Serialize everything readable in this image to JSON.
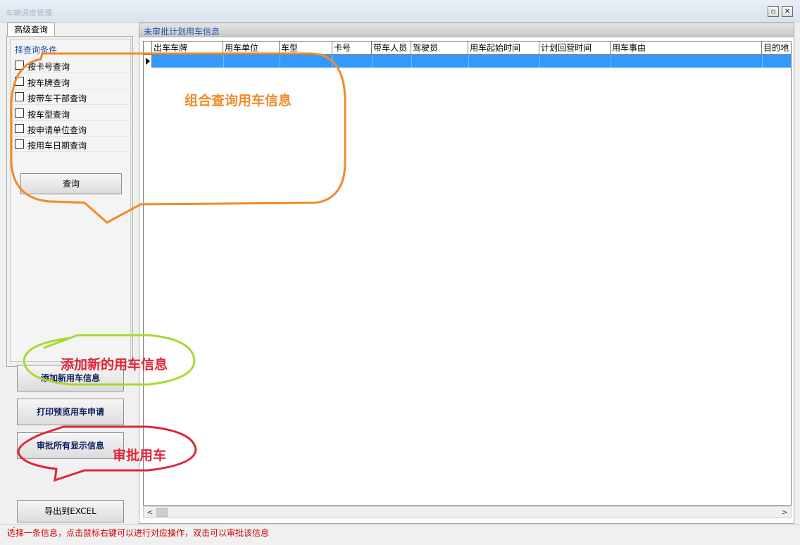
{
  "window": {
    "title": "车辆调度管理"
  },
  "left": {
    "tab_label": "高级查询",
    "group_title": "择查询条件",
    "checkboxes": [
      {
        "label": "按卡号查询"
      },
      {
        "label": "按车牌查询"
      },
      {
        "label": "按带车干部查询"
      },
      {
        "label": "按车型查询"
      },
      {
        "label": "按申请单位查询"
      },
      {
        "label": "按用车日期查询"
      }
    ],
    "query_button": "查询",
    "add_button": "添加新用车信息",
    "print_button": "打印预览用车申请",
    "approve_button": "审批所有显示信息",
    "export_button": "导出到EXCEL"
  },
  "right": {
    "panel_title": "未审批计划用车信息",
    "columns": [
      "出车车牌",
      "用车单位",
      "车型",
      "卡号",
      "带车人员",
      "驾驶员",
      "用车起始时间",
      "计划回营时间",
      "用车事由",
      "目的地"
    ]
  },
  "status_text": "选择一条信息，点击鼠标右键可以进行对应操作，双击可以审批该信息",
  "annotations": {
    "combo": "组合查询用车信息",
    "add": "添加新的用车信息",
    "approve": "审批用车"
  },
  "colors": {
    "orange": "#f08a2c",
    "green": "#a8d832",
    "red": "#e0263a",
    "selection": "#3399ff",
    "link_blue": "#2356b3"
  }
}
